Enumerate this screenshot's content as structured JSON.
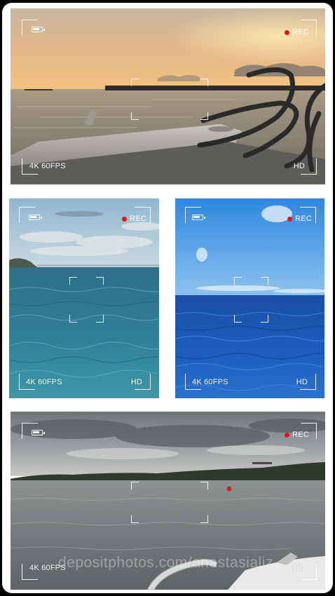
{
  "colors": {
    "card_background": "#ffffff",
    "frame_background": "#000000",
    "rec_dot": "#e3161b",
    "hud_white": "#ffffff"
  },
  "panels": [
    {
      "id": "sunset-boat",
      "battery_icon": "battery-icon",
      "rec_label": "REC",
      "resolution_label": "4K 60FPS",
      "quality_label": "HD",
      "scene": "sunset sea with boat bow and ropes"
    },
    {
      "id": "coastline-sea",
      "battery_icon": "battery-icon",
      "rec_label": "REC",
      "resolution_label": "4K 60FPS",
      "quality_label": "HD",
      "scene": "open sea with distant city coastline"
    },
    {
      "id": "blue-sea",
      "battery_icon": "battery-icon",
      "rec_label": "REC",
      "resolution_label": "4K 60FPS",
      "quality_label": "HD",
      "scene": "deep blue sea under clear sky"
    },
    {
      "id": "cloudy-river",
      "battery_icon": "battery-icon",
      "rec_label": "REC",
      "resolution_label": "4K 60FPS",
      "quality_label": "HD",
      "scene": "cloudy sky over calm water with treeline"
    }
  ],
  "watermark": "depositphotos.com/anastasializ"
}
